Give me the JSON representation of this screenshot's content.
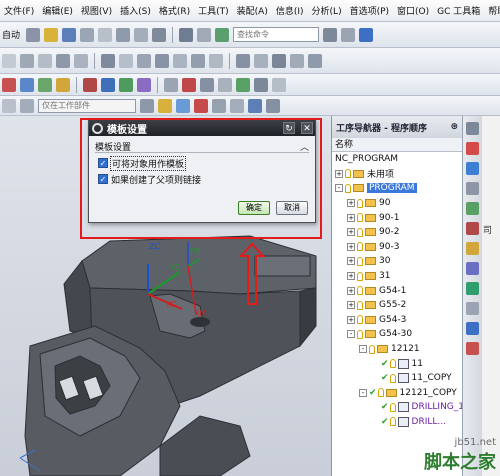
{
  "menu": [
    "文件(F)",
    "编辑(E)",
    "视图(V)",
    "插入(S)",
    "格式(R)",
    "工具(T)",
    "装配(A)",
    "信息(I)",
    "分析(L)",
    "首选项(P)",
    "窗口(O)",
    "GC 工具箱",
    "帮助(H)"
  ],
  "toolbar": {
    "mode_label": "自动",
    "search_placeholder": "查找命令",
    "filter_placeholder": "仅在工作部件"
  },
  "dialog": {
    "title": "模板设置",
    "group_label": "模板设置",
    "options": [
      {
        "label": "可将对象用作模板",
        "checked": true
      },
      {
        "label": "如果创建了父项则链接",
        "checked": true
      }
    ],
    "ok_label": "确定",
    "cancel_label": "取消"
  },
  "axes": {
    "zc": "ZC",
    "yc": "YC",
    "xc": "XC",
    "ym": "YM",
    "xm": "XM"
  },
  "navigator": {
    "title": "工序导航器 - 程序顺序",
    "column_header": "名称",
    "root": "NC_PROGRAM",
    "rows": [
      {
        "label": "未用项",
        "indent": 0,
        "expander": "+",
        "check": false,
        "icon": "folder",
        "selected": false,
        "purple": false
      },
      {
        "label": "PROGRAM",
        "indent": 0,
        "expander": "-",
        "check": false,
        "icon": "folder",
        "selected": true,
        "purple": false
      },
      {
        "label": "90",
        "indent": 1,
        "expander": "+",
        "check": false,
        "icon": "folder",
        "selected": false,
        "purple": false
      },
      {
        "label": "90-1",
        "indent": 1,
        "expander": "+",
        "check": false,
        "icon": "folder",
        "selected": false,
        "purple": false
      },
      {
        "label": "90-2",
        "indent": 1,
        "expander": "+",
        "check": false,
        "icon": "folder",
        "selected": false,
        "purple": false
      },
      {
        "label": "90-3",
        "indent": 1,
        "expander": "+",
        "check": false,
        "icon": "folder",
        "selected": false,
        "purple": false
      },
      {
        "label": "30",
        "indent": 1,
        "expander": "+",
        "check": false,
        "icon": "folder",
        "selected": false,
        "purple": false
      },
      {
        "label": "31",
        "indent": 1,
        "expander": "+",
        "check": false,
        "icon": "folder",
        "selected": false,
        "purple": false
      },
      {
        "label": "G54-1",
        "indent": 1,
        "expander": "+",
        "check": false,
        "icon": "folder",
        "selected": false,
        "purple": false
      },
      {
        "label": "G55-2",
        "indent": 1,
        "expander": "+",
        "check": false,
        "icon": "folder",
        "selected": false,
        "purple": false
      },
      {
        "label": "G54-3",
        "indent": 1,
        "expander": "+",
        "check": false,
        "icon": "folder",
        "selected": false,
        "purple": false
      },
      {
        "label": "G54-30",
        "indent": 1,
        "expander": "-",
        "check": false,
        "icon": "folder",
        "selected": false,
        "purple": false
      },
      {
        "label": "12121",
        "indent": 2,
        "expander": "-",
        "check": false,
        "icon": "folder",
        "selected": false,
        "purple": false
      },
      {
        "label": "11",
        "indent": 3,
        "expander": "",
        "check": true,
        "icon": "op",
        "selected": false,
        "purple": false
      },
      {
        "label": "11_COPY",
        "indent": 3,
        "expander": "",
        "check": true,
        "icon": "op",
        "selected": false,
        "purple": false
      },
      {
        "label": "12121_COPY",
        "indent": 2,
        "expander": "-",
        "check": true,
        "icon": "folder",
        "selected": false,
        "purple": false
      },
      {
        "label": "DRILLING_1",
        "indent": 3,
        "expander": "",
        "check": true,
        "icon": "op",
        "selected": false,
        "purple": true
      },
      {
        "label": "DRILL...",
        "indent": 3,
        "expander": "",
        "check": true,
        "icon": "op",
        "selected": false,
        "purple": true
      }
    ]
  },
  "side_text": "司",
  "watermark": {
    "url": "jb51.net",
    "name": "脚本之家"
  },
  "colors": {
    "highlight_red": "#e31b1b",
    "selection_blue": "#3a78d9",
    "check_green": "#2f9e2f",
    "dialog_title": "#2a2d32"
  }
}
